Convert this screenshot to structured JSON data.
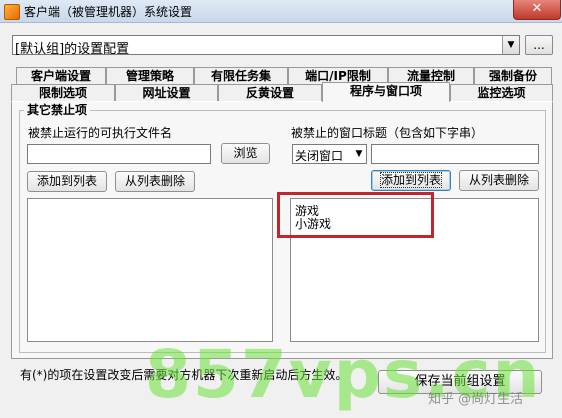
{
  "window": {
    "title": "客户端（被管理机器）系统设置",
    "close_label": "✕"
  },
  "group_combo": {
    "value": "[默认组]的设置配置",
    "dots_label": "..."
  },
  "tabs": {
    "row1": [
      "客户端设置",
      "管理策略",
      "有限任务集",
      "端口/IP限制",
      "流量控制",
      "强制备份"
    ],
    "row2": [
      "限制选项",
      "网址设置",
      "反黄设置",
      "程序与窗口项",
      "监控选项"
    ],
    "active": "程序与窗口项"
  },
  "group": {
    "title": "其它禁止项"
  },
  "left": {
    "label": "被禁止运行的可执行文件名",
    "input_value": "",
    "browse_label": "浏览",
    "add_label": "添加到列表",
    "remove_label": "从列表删除",
    "items": []
  },
  "right": {
    "label": "被禁止的窗口标题（包含如下字串）",
    "action_value": "关闭窗口",
    "input_value": "",
    "add_label": "添加到列表",
    "remove_label": "从列表删除",
    "items": [
      "游戏",
      "小游戏"
    ]
  },
  "footer": {
    "note": "有(*)的项在设置改变后需要对方机器下次重新启动后方生效。",
    "save_label": "保存当前组设置"
  },
  "watermarks": {
    "big": "857vps.cn",
    "small": "知乎 @尚灯生活"
  },
  "colors": {
    "highlight": "#c0272d",
    "watermark": "#6ee13c"
  }
}
